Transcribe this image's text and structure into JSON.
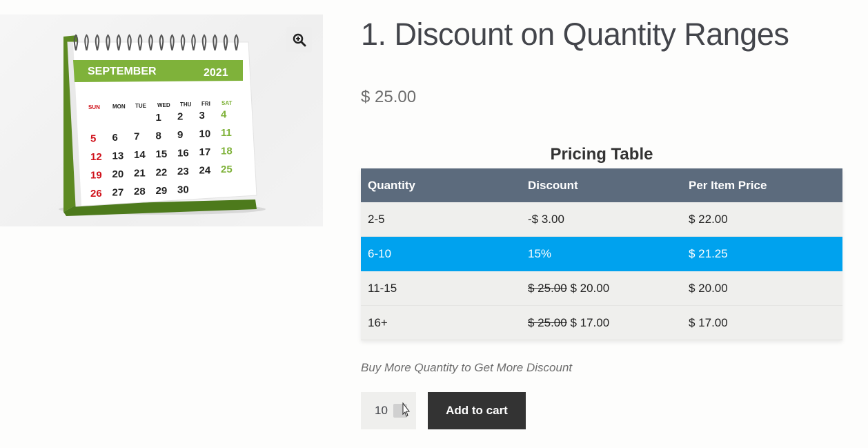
{
  "product": {
    "title": "1. Discount on Quantity Ranges",
    "price": "$ 25.00",
    "image": {
      "icon": "calendar-icon",
      "calendar": {
        "month": "SEPTEMBER",
        "year": "2021",
        "days": [
          "SUN",
          "MON",
          "TUE",
          "WED",
          "THU",
          "FRI",
          "SAT"
        ],
        "weeks": [
          [
            "",
            "",
            "",
            "1",
            "2",
            "3",
            "4"
          ],
          [
            "5",
            "6",
            "7",
            "8",
            "9",
            "10",
            "11"
          ],
          [
            "12",
            "13",
            "14",
            "15",
            "16",
            "17",
            "18"
          ],
          [
            "19",
            "20",
            "21",
            "22",
            "23",
            "24",
            "25"
          ],
          [
            "26",
            "27",
            "28",
            "29",
            "30",
            "",
            ""
          ]
        ],
        "colors": {
          "header_bar": "#7fb23a",
          "sunday": "#d0121b",
          "saturday": "#7fb23a"
        }
      }
    },
    "zoom_icon": "zoom-in-icon"
  },
  "pricing_table": {
    "caption": "Pricing Table",
    "headers": [
      "Quantity",
      "Discount",
      "Per Item Price"
    ],
    "rows": [
      {
        "quantity": "2-5",
        "discount_old": "",
        "discount": "-$ 3.00",
        "price": "$ 22.00",
        "active": false
      },
      {
        "quantity": "6-10",
        "discount_old": "",
        "discount": "15%",
        "price": "$ 21.25",
        "active": true
      },
      {
        "quantity": "11-15",
        "discount_old": "$ 25.00",
        "discount": "$ 20.00",
        "price": "$ 20.00",
        "active": false
      },
      {
        "quantity": "16+",
        "discount_old": "$ 25.00",
        "discount": "$ 17.00",
        "price": "$ 17.00",
        "active": false
      }
    ],
    "colors": {
      "header": "#5c6b7d",
      "active_row": "#00a2ee",
      "row": "#efefed"
    }
  },
  "note": "Buy More Quantity to Get More Discount",
  "cart": {
    "quantity": "10",
    "add_label": "Add to cart"
  }
}
